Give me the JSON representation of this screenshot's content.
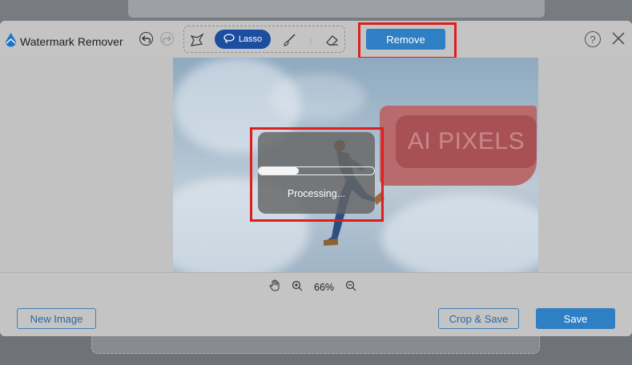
{
  "app": {
    "title": "Watermark Remover"
  },
  "toolbar": {
    "lasso_label": "Lasso",
    "remove_label": "Remove",
    "help_symbol": "?"
  },
  "canvas": {
    "mask_text": "AI PIXELS",
    "processing_label": "Processing...",
    "progress_fraction": 0.35
  },
  "zoom": {
    "level": "66%"
  },
  "footer": {
    "new_image_label": "New Image",
    "crop_save_label": "Crop & Save",
    "save_label": "Save"
  },
  "icons": [
    "logo-drop-icon",
    "undo-icon",
    "redo-icon",
    "polygon-lasso-icon",
    "lasso-icon",
    "brush-icon",
    "eraser-icon",
    "help-icon",
    "close-icon",
    "hand-pan-icon",
    "zoom-in-icon",
    "zoom-out-icon"
  ],
  "colors": {
    "accent": "#2e7fc3",
    "lasso_active": "#1c4ea0",
    "highlight": "#e01d1d",
    "mask": "#b86a6d"
  }
}
